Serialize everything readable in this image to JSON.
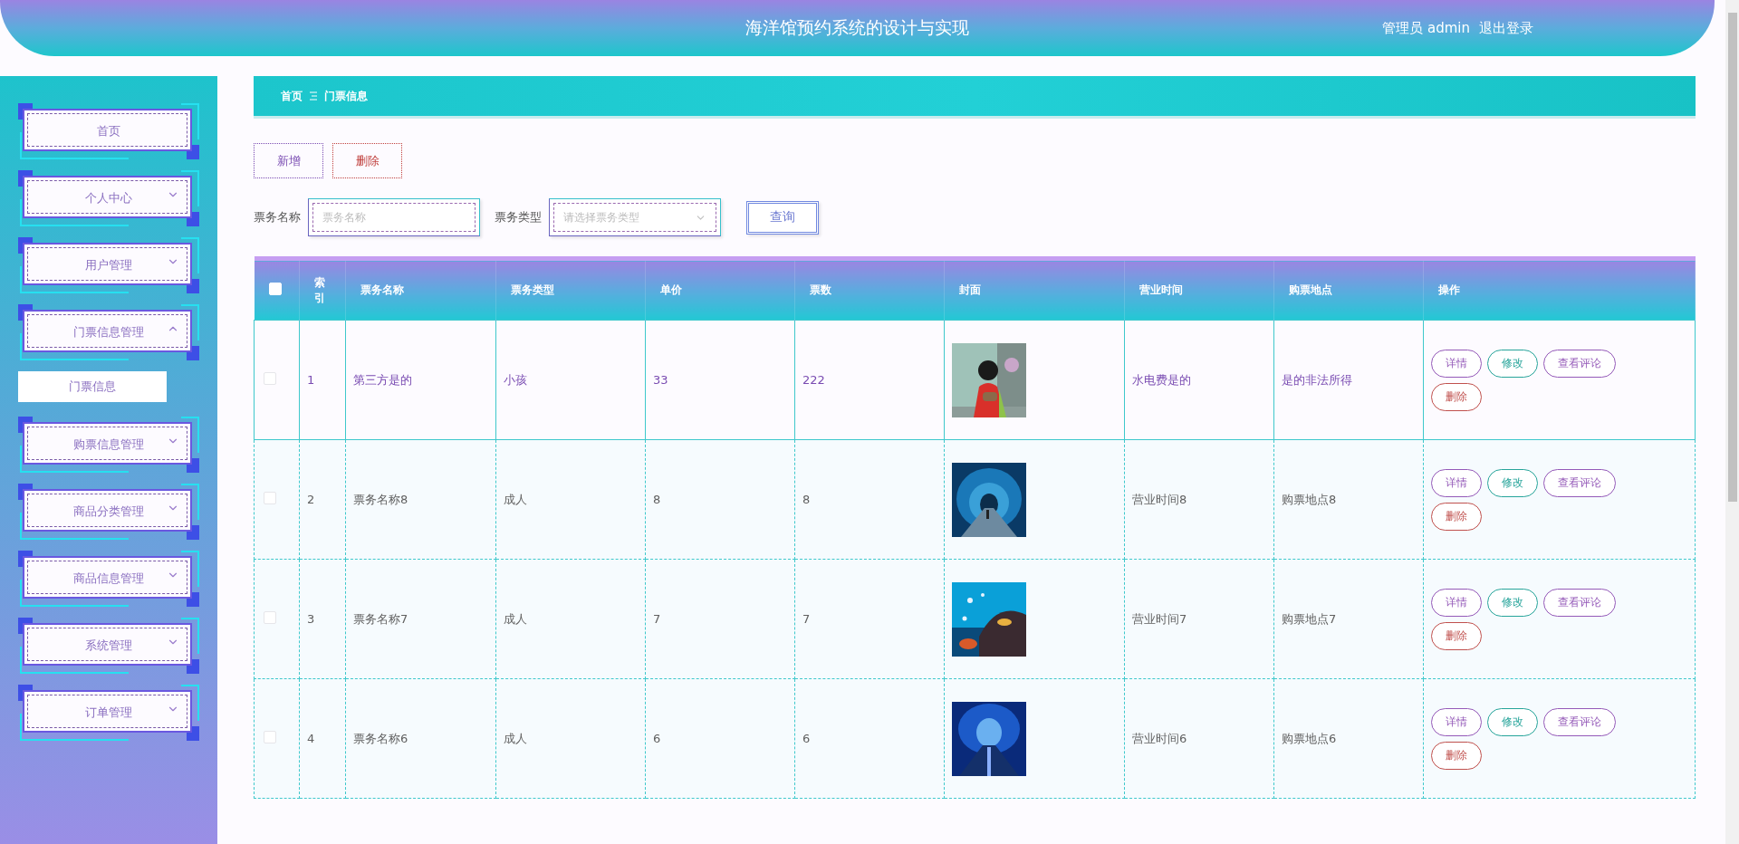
{
  "header": {
    "title": "海洋馆预约系统的设计与实现",
    "user": "管理员 admin",
    "logout": "退出登录"
  },
  "sidebar": {
    "items": [
      {
        "label": "首页",
        "kind": "link"
      },
      {
        "label": "个人中心",
        "kind": "menu",
        "expanded": false
      },
      {
        "label": "用户管理",
        "kind": "menu",
        "expanded": false
      },
      {
        "label": "门票信息管理",
        "kind": "menu",
        "expanded": true,
        "children": [
          {
            "label": "门票信息",
            "selected": true
          }
        ]
      },
      {
        "label": "购票信息管理",
        "kind": "menu",
        "expanded": false
      },
      {
        "label": "商品分类管理",
        "kind": "menu",
        "expanded": false
      },
      {
        "label": "商品信息管理",
        "kind": "menu",
        "expanded": false
      },
      {
        "label": "系统管理",
        "kind": "menu",
        "expanded": false
      },
      {
        "label": "订单管理",
        "kind": "menu",
        "expanded": false
      }
    ]
  },
  "breadcrumb": [
    "首页",
    "门票信息"
  ],
  "toolbar": [
    {
      "label": "新增",
      "kind": "add"
    },
    {
      "label": "删除",
      "kind": "delete"
    }
  ],
  "search": {
    "fields": [
      {
        "label": "票务名称",
        "placeholder": "票务名称",
        "kind": "input"
      },
      {
        "label": "票务类型",
        "placeholder": "请选择票务类型",
        "kind": "select"
      }
    ],
    "button": "查询"
  },
  "table": {
    "select_all": {
      "checked": false
    },
    "columns": [
      "索引",
      "票务名称",
      "票务类型",
      "单价",
      "票数",
      "封面",
      "营业时间",
      "购票地点",
      "操作"
    ],
    "rows": [
      {
        "index": "1",
        "name": "第三方是的",
        "type": "小孩",
        "price": "33",
        "count": "222",
        "hours": "水电费是的",
        "place": "是的非法所得",
        "checked": false,
        "selected": true,
        "actions": [
          {
            "label": "详情",
            "kind": "detail"
          },
          {
            "label": "修改",
            "kind": "edit"
          },
          {
            "label": "查看评论",
            "kind": "comments"
          },
          {
            "label": "删除",
            "kind": "delete"
          }
        ]
      },
      {
        "index": "2",
        "name": "票务名称8",
        "type": "成人",
        "price": "8",
        "count": "8",
        "hours": "营业时间8",
        "place": "购票地点8",
        "checked": false,
        "selected": false,
        "actions": [
          {
            "label": "详情",
            "kind": "detail"
          },
          {
            "label": "修改",
            "kind": "edit"
          },
          {
            "label": "查看评论",
            "kind": "comments"
          },
          {
            "label": "删除",
            "kind": "delete"
          }
        ]
      },
      {
        "index": "3",
        "name": "票务名称7",
        "type": "成人",
        "price": "7",
        "count": "7",
        "hours": "营业时间7",
        "place": "购票地点7",
        "checked": false,
        "selected": false,
        "actions": [
          {
            "label": "详情",
            "kind": "detail"
          },
          {
            "label": "修改",
            "kind": "edit"
          },
          {
            "label": "查看评论",
            "kind": "comments"
          },
          {
            "label": "删除",
            "kind": "delete"
          }
        ]
      },
      {
        "index": "4",
        "name": "票务名称6",
        "type": "成人",
        "price": "6",
        "count": "6",
        "hours": "营业时间6",
        "place": "购票地点6",
        "checked": false,
        "selected": false,
        "actions": [
          {
            "label": "详情",
            "kind": "detail"
          },
          {
            "label": "修改",
            "kind": "edit"
          },
          {
            "label": "查看评论",
            "kind": "comments"
          },
          {
            "label": "删除",
            "kind": "delete"
          }
        ]
      }
    ]
  }
}
